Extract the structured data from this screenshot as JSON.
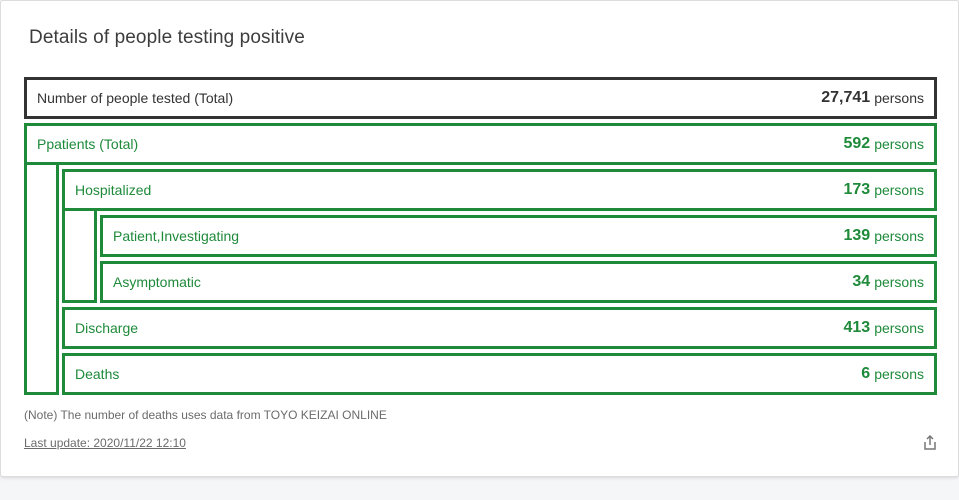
{
  "card": {
    "title": "Details of people testing positive",
    "note": "(Note) The number of deaths uses data from TOYO KEIZAI ONLINE",
    "last_update": "Last update: 2020/11/22 12:10",
    "share_icon": "share-icon"
  },
  "colors": {
    "accent": "#1e8a3a",
    "total_border": "#333333"
  },
  "rows": {
    "tested": {
      "label": "Number of people tested (Total)",
      "value": "27,741",
      "unit": "persons"
    },
    "patients": {
      "label": "Ppatients (Total)",
      "value": "592",
      "unit": "persons"
    },
    "hospitalized": {
      "label": "Hospitalized",
      "value": "173",
      "unit": "persons"
    },
    "investigating": {
      "label": "Patient,Investigating",
      "value": "139",
      "unit": "persons"
    },
    "asymptomatic": {
      "label": "Asymptomatic",
      "value": "34",
      "unit": "persons"
    },
    "discharge": {
      "label": "Discharge",
      "value": "413",
      "unit": "persons"
    },
    "deaths": {
      "label": "Deaths",
      "value": "6",
      "unit": "persons"
    }
  }
}
